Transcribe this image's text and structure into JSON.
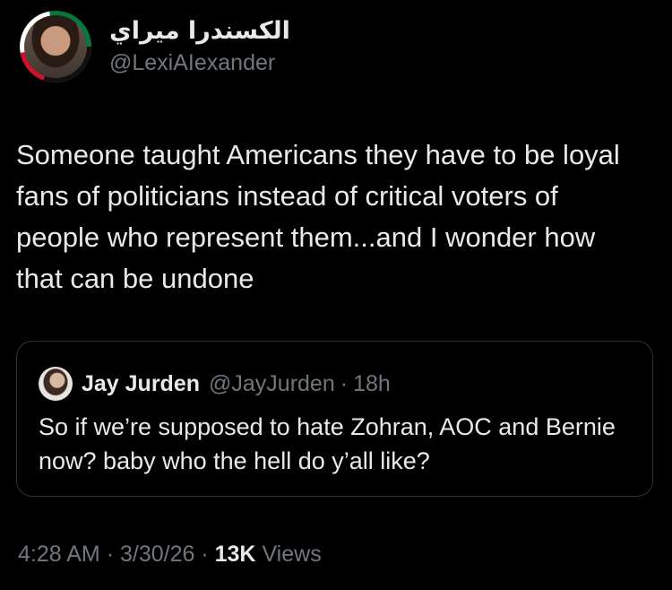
{
  "author": {
    "display_name": "الكسندرا ميراي",
    "handle": "@LexiAIexander",
    "avatar_icon": "profile-photo-with-palestine-flag-ring"
  },
  "tweet": {
    "text": "Someone taught Americans they have to be loyal fans of politicians instead of critical voters of people who represent them...and I wonder how that can be undone"
  },
  "quoted_tweet": {
    "display_name": "Jay Jurden",
    "handle": "@JayJurden",
    "separator": "·",
    "time": "18h",
    "text": "So if we’re supposed to hate Zohran, AOC and Bernie now? baby who the hell do y’all like?"
  },
  "meta": {
    "time": "4:28 AM",
    "sep1": "·",
    "date": "3/30/26",
    "sep2": "·",
    "views_count": "13K",
    "views_label": "Views"
  },
  "colors": {
    "background": "#000000",
    "primary_text": "#e7e9ea",
    "secondary_text": "#71767b",
    "border": "#2f3336"
  }
}
